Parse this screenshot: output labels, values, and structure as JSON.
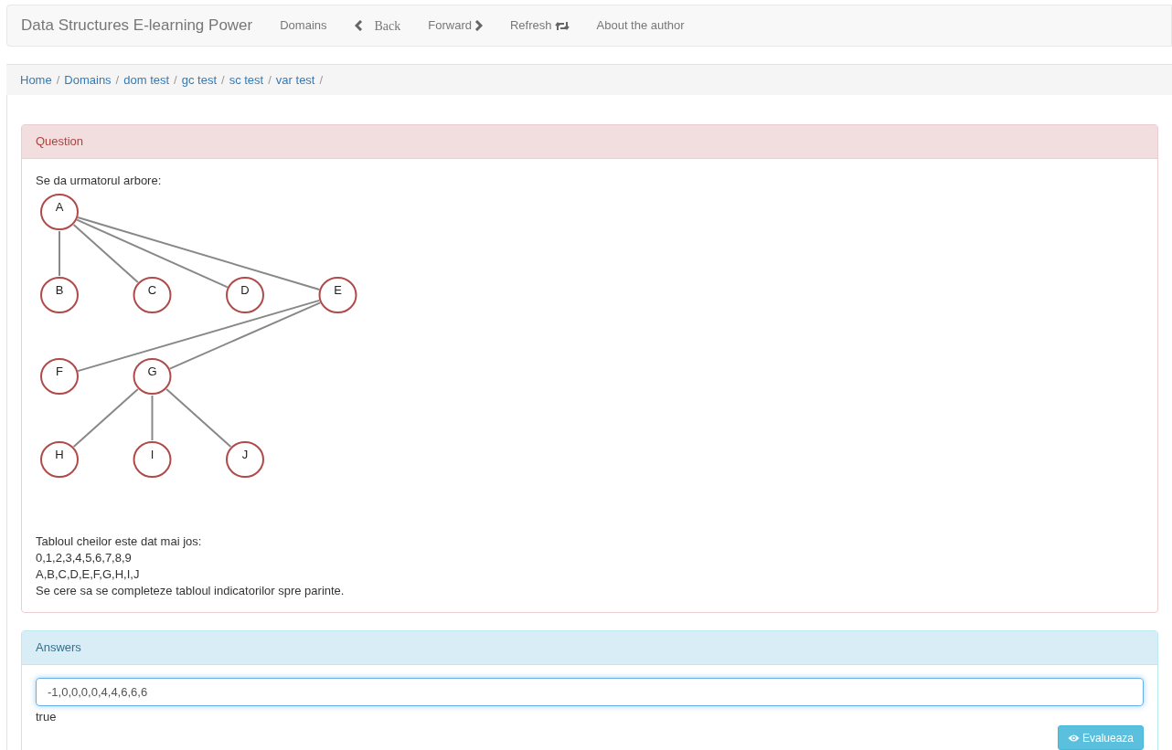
{
  "navbar": {
    "brand": "Data Structures E-learning Power",
    "items": [
      {
        "label": "Domains",
        "kind": "link"
      },
      {
        "label": "Back",
        "kind": "back"
      },
      {
        "label": "Forward",
        "kind": "forward"
      },
      {
        "label": "Refresh",
        "kind": "refresh"
      },
      {
        "label": "About the author",
        "kind": "link"
      }
    ]
  },
  "breadcrumb": [
    {
      "label": "Home",
      "separator": "/"
    },
    {
      "label": "Domains",
      "separator": "/"
    },
    {
      "label": "dom test",
      "separator": "/"
    },
    {
      "label": "gc test",
      "separator": "/"
    },
    {
      "label": "sc test",
      "separator": "/"
    },
    {
      "label": "var test",
      "separator": "/"
    }
  ],
  "question": {
    "title": "Question",
    "intro": "Se da urmatorul arbore:",
    "tree": {
      "label": "A",
      "children": [
        {
          "label": "B"
        },
        {
          "label": "C"
        },
        {
          "label": "D"
        },
        {
          "label": "E",
          "children": [
            {
              "label": "F"
            },
            {
              "label": "G",
              "children": [
                {
                  "label": "H"
                },
                {
                  "label": "I"
                },
                {
                  "label": "J"
                }
              ]
            }
          ]
        }
      ]
    },
    "lines": [
      "Tabloul cheilor este dat mai jos:",
      "0,1,2,3,4,5,6,7,8,9",
      "A,B,C,D,E,F,G,H,I,J",
      "Se cere sa se completeze tabloul indicatorilor spre parinte."
    ]
  },
  "answers": {
    "title": "Answers",
    "value": "-1,0,0,0,0,4,4,6,6,6",
    "result": "true",
    "button": "Evalueaza"
  }
}
